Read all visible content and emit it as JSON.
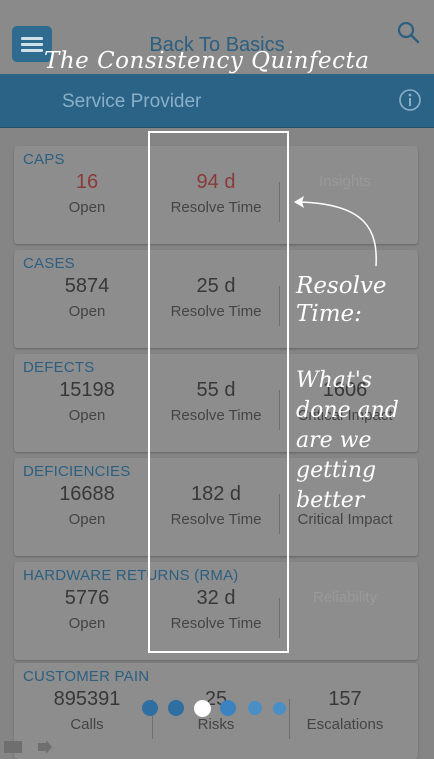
{
  "header": {
    "title": "Back To Basics",
    "overlay_heading": "The Consistency Quinfecta"
  },
  "section_bar": {
    "title": "Service Provider"
  },
  "cards": [
    {
      "title": "CAPS",
      "metrics": [
        {
          "value": "16",
          "label": "Open"
        },
        {
          "value": "94 d",
          "label": "Resolve Time"
        },
        {
          "value": "Insights",
          "label": ""
        }
      ]
    },
    {
      "title": "CASES",
      "metrics": [
        {
          "value": "5874",
          "label": "Open"
        },
        {
          "value": "25 d",
          "label": "Resolve Time"
        },
        {
          "value": "",
          "label": ""
        }
      ]
    },
    {
      "title": "DEFECTS",
      "metrics": [
        {
          "value": "15198",
          "label": "Open"
        },
        {
          "value": "55 d",
          "label": "Resolve Time"
        },
        {
          "value": "1606",
          "label": "Critical Impact"
        }
      ]
    },
    {
      "title": "DEFICIENCIES",
      "metrics": [
        {
          "value": "16688",
          "label": "Open"
        },
        {
          "value": "182 d",
          "label": "Resolve Time"
        },
        {
          "value": "",
          "label": "Critical Impact"
        }
      ]
    },
    {
      "title": "HARDWARE RETURNS (RMA)",
      "metrics": [
        {
          "value": "5776",
          "label": "Open"
        },
        {
          "value": "32 d",
          "label": "Resolve Time"
        },
        {
          "value": "Reliability",
          "label": ""
        }
      ]
    },
    {
      "title": "CUSTOMER PAIN",
      "metrics": [
        {
          "value": "895391",
          "label": "Calls"
        },
        {
          "value": "25",
          "label": "Risks"
        },
        {
          "value": "157",
          "label": "Escalations"
        }
      ]
    }
  ],
  "annotation": {
    "title": "Resolve Time:",
    "body": "What's done and are we getting better"
  },
  "pager": {
    "total": 6,
    "active_index": 2
  },
  "colors": {
    "accent": "#2a6386",
    "highlight": "#ffffff",
    "alert_value": "#8a3a3a"
  }
}
